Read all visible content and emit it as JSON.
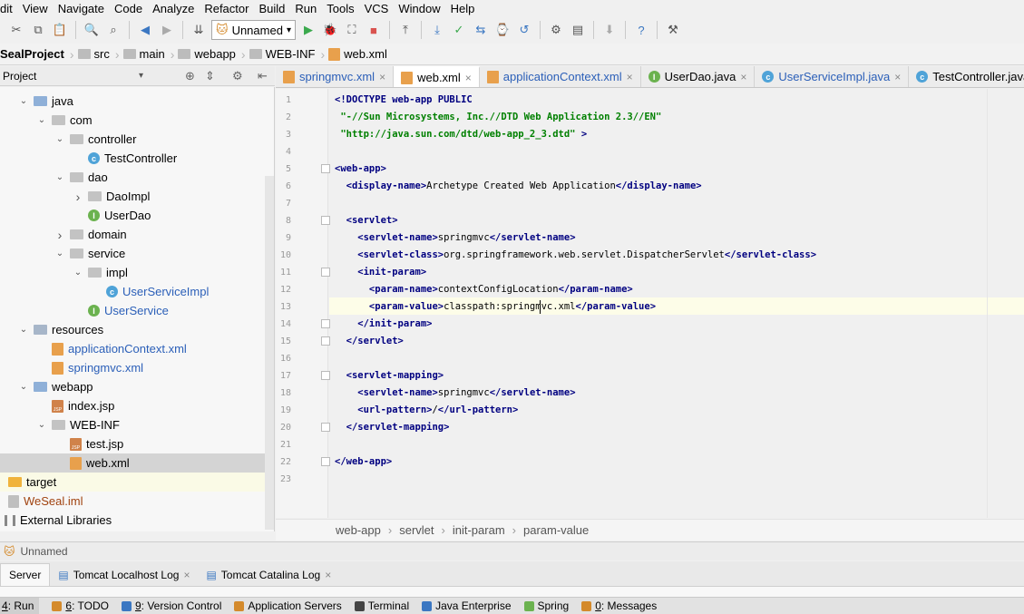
{
  "menubar": [
    "dit",
    "View",
    "Navigate",
    "Code",
    "Analyze",
    "Refactor",
    "Build",
    "Run",
    "Tools",
    "VCS",
    "Window",
    "Help"
  ],
  "toolbar": {
    "run_config": "Unnamed"
  },
  "breadcrumb": [
    "SealProject",
    "src",
    "main",
    "webapp",
    "WEB-INF",
    "web.xml"
  ],
  "project_panel": {
    "title": "Project",
    "tree": [
      {
        "label": "java",
        "indent": 1,
        "chev": "down",
        "icon": "folder-src",
        "color": "default"
      },
      {
        "label": "com",
        "indent": 2,
        "chev": "down",
        "icon": "package",
        "color": "default"
      },
      {
        "label": "controller",
        "indent": 3,
        "chev": "down",
        "icon": "package",
        "color": "default"
      },
      {
        "label": "TestController",
        "indent": 4,
        "chev": "",
        "icon": "class",
        "color": "default"
      },
      {
        "label": "dao",
        "indent": 3,
        "chev": "down",
        "icon": "package",
        "color": "default"
      },
      {
        "label": "DaoImpl",
        "indent": 4,
        "chev": "right",
        "icon": "package",
        "color": "default"
      },
      {
        "label": "UserDao",
        "indent": 4,
        "chev": "",
        "icon": "interface",
        "color": "default"
      },
      {
        "label": "domain",
        "indent": 3,
        "chev": "right",
        "icon": "package",
        "color": "default"
      },
      {
        "label": "service",
        "indent": 3,
        "chev": "down",
        "icon": "package",
        "color": "default"
      },
      {
        "label": "impl",
        "indent": 4,
        "chev": "down",
        "icon": "package",
        "color": "default"
      },
      {
        "label": "UserServiceImpl",
        "indent": 5,
        "chev": "",
        "icon": "class",
        "color": "blue"
      },
      {
        "label": "UserService",
        "indent": 4,
        "chev": "",
        "icon": "interface",
        "color": "blue"
      },
      {
        "label": "resources",
        "indent": 1,
        "chev": "down",
        "icon": "folder",
        "color": "default"
      },
      {
        "label": "applicationContext.xml",
        "indent": 2,
        "chev": "",
        "icon": "xml",
        "color": "blue"
      },
      {
        "label": "springmvc.xml",
        "indent": 2,
        "chev": "",
        "icon": "xml",
        "color": "blue"
      },
      {
        "label": "webapp",
        "indent": 1,
        "chev": "down",
        "icon": "folder-src",
        "color": "default"
      },
      {
        "label": "index.jsp",
        "indent": 2,
        "chev": "",
        "icon": "jsp",
        "color": "default"
      },
      {
        "label": "WEB-INF",
        "indent": 2,
        "chev": "down",
        "icon": "package",
        "color": "default"
      },
      {
        "label": "test.jsp",
        "indent": 3,
        "chev": "",
        "icon": "jsp",
        "color": "default"
      },
      {
        "label": "web.xml",
        "indent": 3,
        "chev": "",
        "icon": "xml",
        "color": "default",
        "selected": true
      },
      {
        "label": "target",
        "indent": 0,
        "chev": "right",
        "icon": "folder-orange",
        "color": "default",
        "highlight": true
      },
      {
        "label": "WeSeal.iml",
        "indent": 0,
        "chev": "",
        "icon": "iml",
        "color": "brown"
      },
      {
        "label": "External Libraries",
        "indent": -1,
        "chev": "",
        "icon": "lib",
        "color": "default"
      }
    ]
  },
  "tabs": [
    {
      "label": "springmvc.xml",
      "icon": "xml",
      "color": "blue",
      "active": false
    },
    {
      "label": "web.xml",
      "icon": "xml",
      "color": "default",
      "active": true
    },
    {
      "label": "applicationContext.xml",
      "icon": "xml",
      "color": "blue",
      "active": false
    },
    {
      "label": "UserDao.java",
      "icon": "interface",
      "color": "default",
      "active": false
    },
    {
      "label": "UserServiceImpl.java",
      "icon": "class",
      "color": "blue",
      "active": false
    },
    {
      "label": "TestController.java",
      "icon": "class",
      "color": "default",
      "active": false
    }
  ],
  "code_lines": [
    [
      {
        "t": "tag",
        "v": "<!DOCTYPE web-app PUBLIC"
      }
    ],
    [
      {
        "t": "str",
        "v": " \"-//Sun Microsystems, Inc.//DTD Web Application 2.3//EN\""
      }
    ],
    [
      {
        "t": "str",
        "v": " \"http://java.sun.com/dtd/web-app_2_3.dtd\""
      },
      {
        "t": "tag",
        "v": " >"
      }
    ],
    [],
    [
      {
        "t": "tag",
        "v": "<web-app>"
      }
    ],
    [
      {
        "t": "tag",
        "v": "  <display-name>"
      },
      {
        "t": "txt",
        "v": "Archetype Created Web Application"
      },
      {
        "t": "tag",
        "v": "</display-name>"
      }
    ],
    [],
    [
      {
        "t": "tag",
        "v": "  <servlet>"
      }
    ],
    [
      {
        "t": "tag",
        "v": "    <servlet-name>"
      },
      {
        "t": "txt",
        "v": "springmvc"
      },
      {
        "t": "tag",
        "v": "</servlet-name>"
      }
    ],
    [
      {
        "t": "tag",
        "v": "    <servlet-class>"
      },
      {
        "t": "txt",
        "v": "org.springframework.web.servlet.DispatcherServlet"
      },
      {
        "t": "tag",
        "v": "</servlet-class>"
      }
    ],
    [
      {
        "t": "tag",
        "v": "    <init-param>"
      }
    ],
    [
      {
        "t": "tag",
        "v": "      <param-name>"
      },
      {
        "t": "txt",
        "v": "contextConfigLocation"
      },
      {
        "t": "tag",
        "v": "</param-name>"
      }
    ],
    [
      {
        "t": "tag",
        "v": "      <param-value>"
      },
      {
        "t": "txt",
        "v": "classpath:springmvc.xml"
      },
      {
        "t": "tag",
        "v": "</param-value>"
      }
    ],
    [
      {
        "t": "tag",
        "v": "    </init-param>"
      }
    ],
    [
      {
        "t": "tag",
        "v": "  </servlet>"
      }
    ],
    [],
    [
      {
        "t": "tag",
        "v": "  <servlet-mapping>"
      }
    ],
    [
      {
        "t": "tag",
        "v": "    <servlet-name>"
      },
      {
        "t": "txt",
        "v": "springmvc"
      },
      {
        "t": "tag",
        "v": "</servlet-name>"
      }
    ],
    [
      {
        "t": "tag",
        "v": "    <url-pattern>"
      },
      {
        "t": "txt",
        "v": "/"
      },
      {
        "t": "tag",
        "v": "</url-pattern>"
      }
    ],
    [
      {
        "t": "tag",
        "v": "  </servlet-mapping>"
      }
    ],
    [],
    [
      {
        "t": "tag",
        "v": "</web-app>"
      }
    ],
    []
  ],
  "fold_lines": [
    5,
    8,
    11,
    14,
    15,
    17,
    20,
    22
  ],
  "editor_breadcrumb": [
    "web-app",
    "servlet",
    "init-param",
    "param-value"
  ],
  "run_panel": {
    "title": "Unnamed",
    "tabs": [
      "Server",
      "Tomcat Localhost Log",
      "Tomcat Catalina Log"
    ]
  },
  "statusbar": [
    {
      "num": "4",
      "label": ": Run"
    },
    {
      "num": "6",
      "label": ": TODO"
    },
    {
      "num": "9",
      "label": ": Version Control"
    },
    {
      "num": "",
      "label": "Application Servers"
    },
    {
      "num": "",
      "label": "Terminal"
    },
    {
      "num": "",
      "label": "Java Enterprise"
    },
    {
      "num": "",
      "label": "Spring"
    },
    {
      "num": "0",
      "label": ": Messages"
    }
  ]
}
